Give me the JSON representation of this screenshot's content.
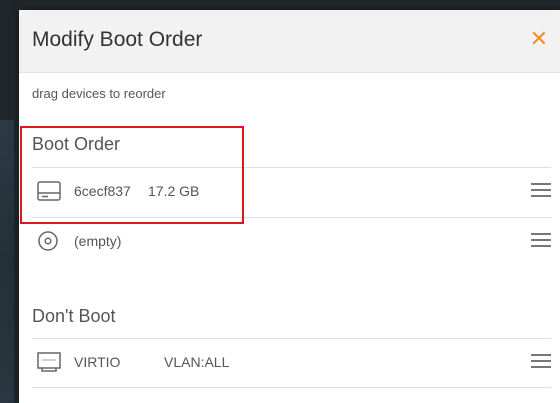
{
  "modal": {
    "title": "Modify Boot Order",
    "close_glyph": "✕",
    "hint": "drag devices to reorder"
  },
  "boot_order": {
    "title": "Boot Order",
    "items": [
      {
        "icon": "hard-disk-icon",
        "name": "6cecf837",
        "detail": "17.2 GB"
      },
      {
        "icon": "optical-disc-icon",
        "name": "(empty)"
      }
    ]
  },
  "dont_boot": {
    "title": "Don't Boot",
    "items": [
      {
        "icon": "network-interface-icon",
        "name": "VIRTIO",
        "detail": "VLAN:ALL"
      }
    ]
  },
  "colors": {
    "accent": "#f0902b",
    "highlight": "#e3141b"
  }
}
